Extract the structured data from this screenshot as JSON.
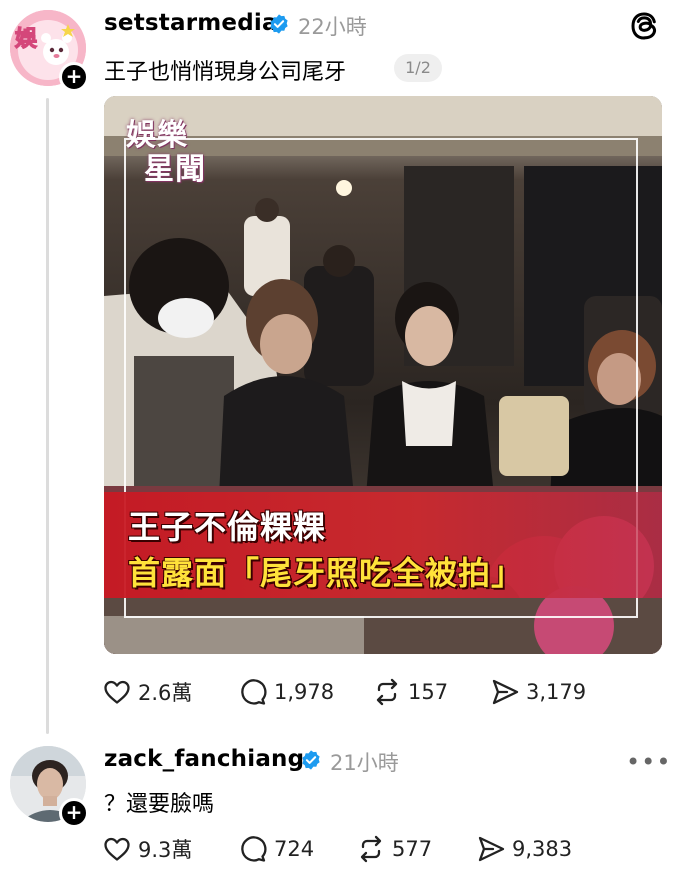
{
  "posts": [
    {
      "username": "setstarmedia",
      "timestamp": "22小時",
      "text": "王子也悄悄現身公司尾牙",
      "page_indicator": "1/2",
      "media": {
        "logo_top": "娛樂",
        "logo_bottom": "星聞",
        "caption_line1": "王子不倫粿粿",
        "caption_line2": "首露面「尾牙照吃全被拍」"
      },
      "stats": {
        "likes": "2.6萬",
        "replies": "1,978",
        "reposts": "157",
        "shares": "3,179"
      }
    },
    {
      "username": "zack_fanchiang",
      "timestamp": "21小時",
      "text": "？還要臉嗎",
      "stats": {
        "likes": "9.3萬",
        "replies": "724",
        "reposts": "577",
        "shares": "9,383"
      }
    }
  ],
  "ui": {
    "follow_symbol": "+",
    "more_symbol": "•••",
    "avatar1_text": "娛"
  },
  "icons": {
    "verified": "verified-badge-icon",
    "threads": "threads-logo-icon",
    "like": "heart-icon",
    "reply": "comment-bubble-icon",
    "repost": "repost-icon",
    "share": "send-icon"
  },
  "colors": {
    "verified_blue": "#1d9bf0",
    "muted_text": "#9a9a9a",
    "caption_red": "#c8191f",
    "caption_yellow": "#ffe23a"
  }
}
